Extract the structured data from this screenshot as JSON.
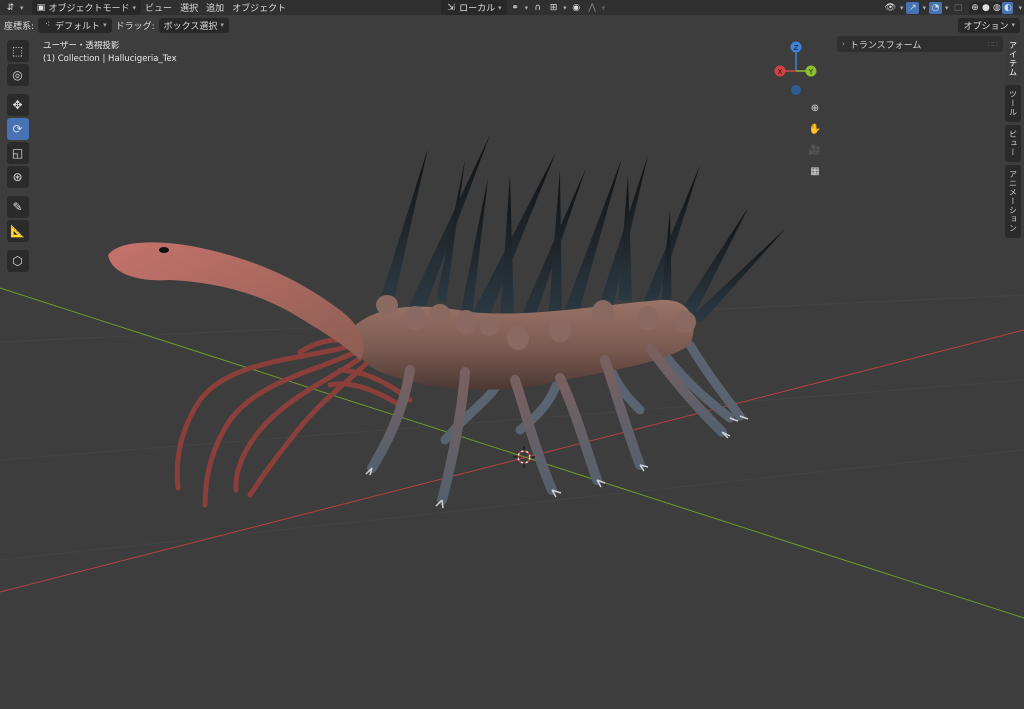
{
  "header": {
    "mode_label": "オブジェクトモード",
    "menu": [
      "ビュー",
      "選択",
      "追加",
      "オブジェクト"
    ],
    "transform_orientation": "ローカル"
  },
  "subheader": {
    "coord_label": "座標系:",
    "coord_value": "デフォルト",
    "drag_label": "ドラッグ:",
    "drag_value": "ボックス選択",
    "options_label": "オプション"
  },
  "viewport": {
    "view_name": "ユーザー・透視投影",
    "collection_info": "(1) Collection | Hallucigeria_Tex"
  },
  "gizmo": {
    "x": "X",
    "y": "Y",
    "z": "Z"
  },
  "n_panel": {
    "transform_label": "トランスフォーム",
    "tabs": [
      "アイテム",
      "ツール",
      "ビュー",
      "アニメーション"
    ]
  },
  "colors": {
    "accent": "#4772b3",
    "x_axis": "#c83a3a",
    "y_axis": "#7fae2a",
    "z_axis": "#2f7fd0"
  },
  "icons": [
    "cursor-select-icon",
    "3d-cursor-icon",
    "move-icon",
    "rotate-icon",
    "scale-icon",
    "transform-icon",
    "annotate-icon",
    "measure-icon",
    "add-cube-icon",
    "zoom-icon",
    "pan-hand-icon",
    "camera-icon",
    "grid-view-icon"
  ]
}
